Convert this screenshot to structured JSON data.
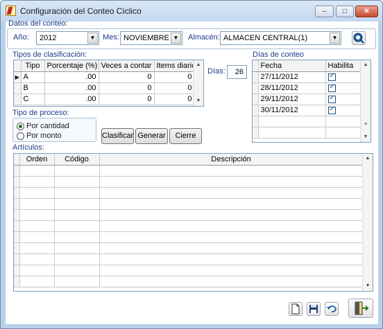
{
  "window": {
    "title": "Configuración del Conteo Cíclico",
    "minimize": "–",
    "maximize": "□",
    "close": "✕"
  },
  "datos": {
    "legend": "Datos del conteo:",
    "anio_label": "Año:",
    "anio_value": "2012",
    "mes_label": "Mes:",
    "mes_value": "NOVIEMBRE",
    "almacen_label": "Almacén:",
    "almacen_value": "ALMACEN CENTRAL(1)"
  },
  "tipos": {
    "legend": "Tipos de clasificación:",
    "columns": [
      "Tipo",
      "Porcentaje (%)",
      "Veces a contar",
      "Items diarios"
    ],
    "rows": [
      {
        "tipo": "A",
        "porcentaje": ".00",
        "veces": "0",
        "items": "0"
      },
      {
        "tipo": "B",
        "porcentaje": ".00",
        "veces": "0",
        "items": "0"
      },
      {
        "tipo": "C",
        "porcentaje": ".00",
        "veces": "0",
        "items": "0"
      }
    ]
  },
  "dias": {
    "label": "Días:",
    "value": "26"
  },
  "dias_conteo": {
    "legend": "Días de conteo",
    "columns": [
      "Fecha",
      "Habilita"
    ],
    "rows": [
      {
        "fecha": "27/11/2012",
        "habilita": true
      },
      {
        "fecha": "28/11/2012",
        "habilita": true
      },
      {
        "fecha": "29/11/2012",
        "habilita": true
      },
      {
        "fecha": "30/11/2012",
        "habilita": true
      }
    ]
  },
  "proceso": {
    "legend": "Tipo de proceso:",
    "options": [
      {
        "label": "Por cantidad",
        "selected": true
      },
      {
        "label": "Por monto",
        "selected": false
      }
    ]
  },
  "buttons": {
    "clasificar": "Clasificar",
    "generar": "Generar",
    "cierre": "Cierre"
  },
  "articulos": {
    "legend": "Artículos:",
    "columns": [
      "Orden",
      "Código",
      "Descripción"
    ]
  }
}
